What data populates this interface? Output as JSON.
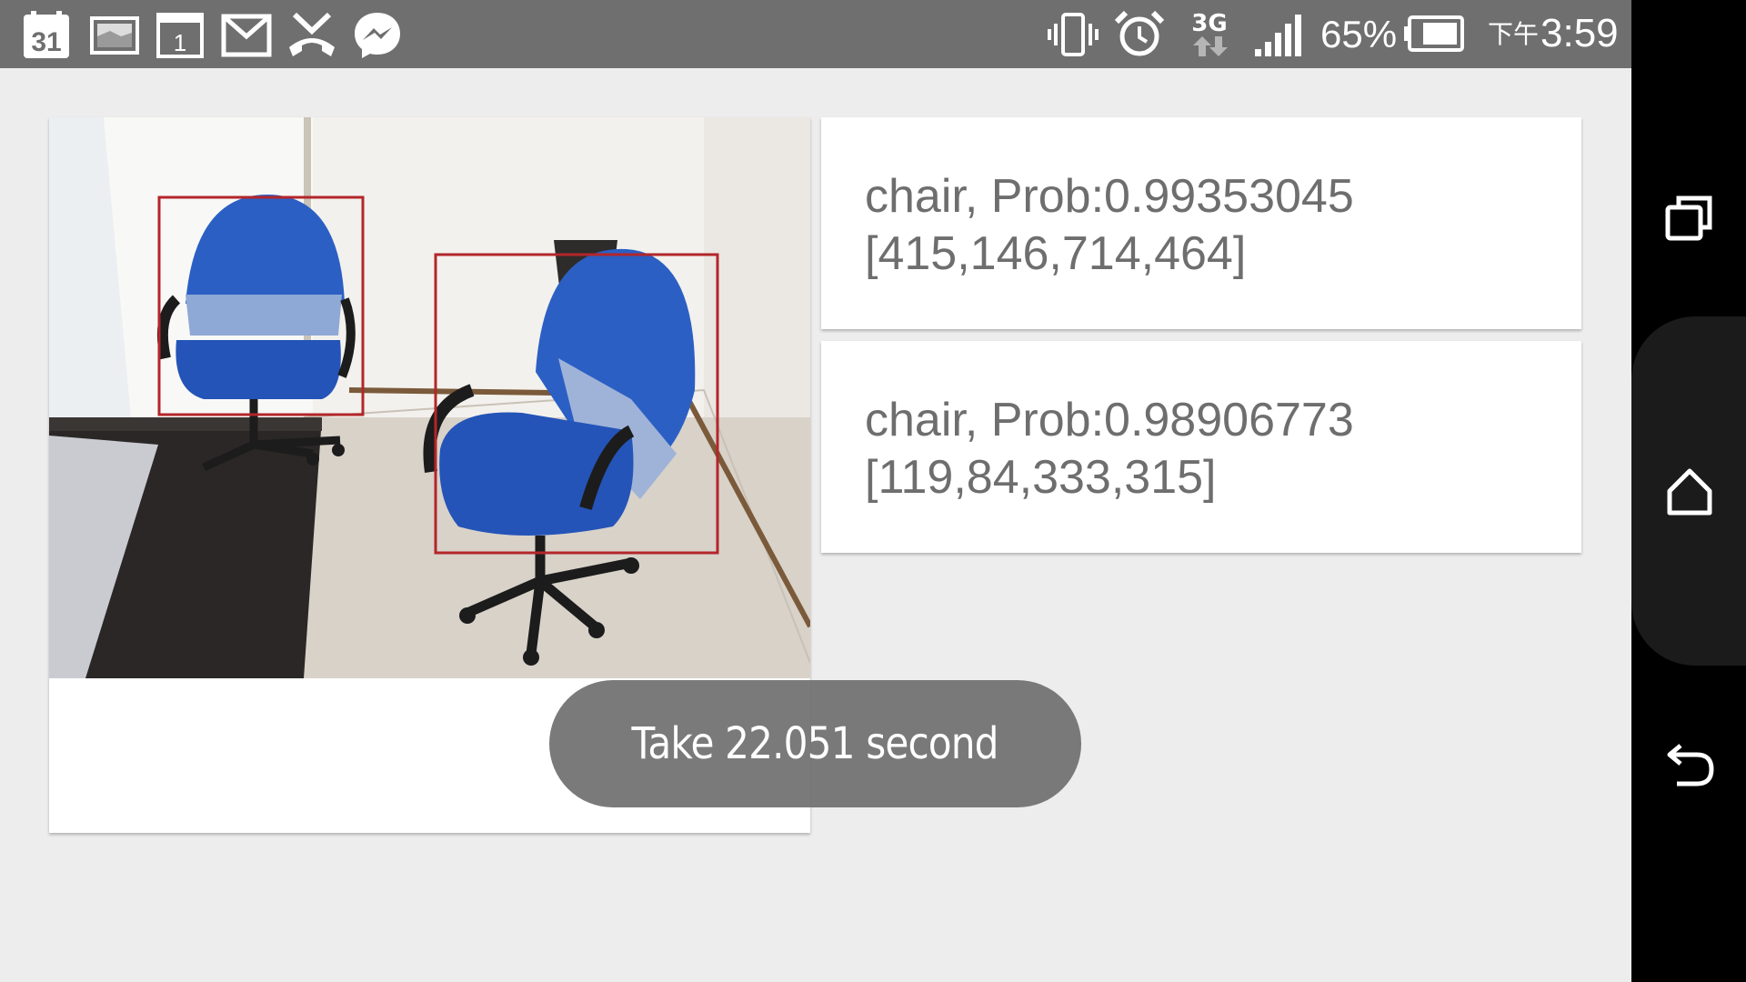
{
  "status_bar": {
    "calendar_day": "31",
    "date_widget_day": "1",
    "battery_percent": "65%",
    "network_type": "3G",
    "clock_ampm": "下午",
    "clock_time": "3:59",
    "notification_icons": [
      "calendar-icon",
      "gallery-icon",
      "date-icon",
      "gmail-icon",
      "missed-call-icon",
      "messenger-icon"
    ],
    "system_icons": [
      "vibrate-icon",
      "alarm-icon",
      "data-3g-icon",
      "signal-icon",
      "battery-icon"
    ]
  },
  "detections": [
    {
      "text": "chair, Prob:0.99353045\n[415,146,714,464]"
    },
    {
      "text": "chair, Prob:0.98906773\n[119,84,333,315]"
    }
  ],
  "toast": {
    "message": "Take 22.051 second"
  },
  "nav_bar": {
    "buttons": [
      "recent-apps-icon",
      "home-icon",
      "back-icon"
    ]
  },
  "colors": {
    "status_bar": "#6f6f6f",
    "bbox": "#b3262a",
    "chair": "#2b5fc4"
  }
}
